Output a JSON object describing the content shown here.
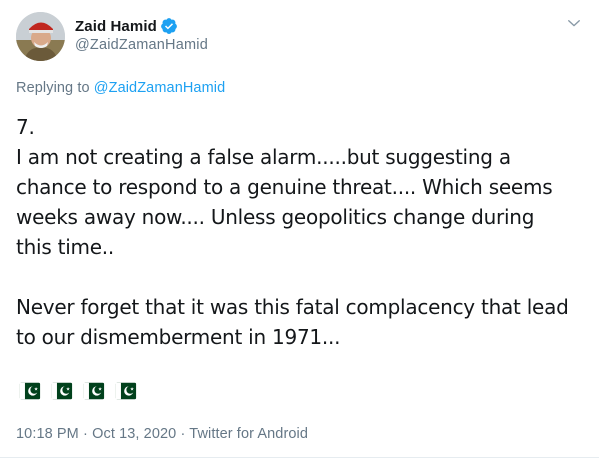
{
  "author": {
    "display_name": "Zaid Hamid",
    "handle": "@ZaidZamanHamid",
    "verified": true
  },
  "reply": {
    "prefix": "Replying to",
    "handle": "@ZaidZamanHamid"
  },
  "tweet": {
    "lines": [
      "7.",
      "I am not creating a false alarm.....but suggesting a",
      "chance to respond to a genuine threat.... Which seems",
      "weeks away now.... Unless geopolitics change during",
      "this time.."
    ],
    "lines_2": [
      "Never forget that it was this fatal complacency that lead",
      "to our dismemberment in 1971..."
    ],
    "emoji_flags": [
      "pakistan-flag",
      "pakistan-flag",
      "pakistan-flag",
      "pakistan-flag"
    ]
  },
  "meta": {
    "time": "10:18 PM",
    "separator_1": "·",
    "date": "Oct 13, 2020",
    "separator_2": "·",
    "source": "Twitter for Android"
  },
  "colors": {
    "text": "#14171a",
    "secondary": "#657786",
    "link": "#1da1f2",
    "verified": "#1da1f2",
    "flag_green": "#01411c"
  }
}
